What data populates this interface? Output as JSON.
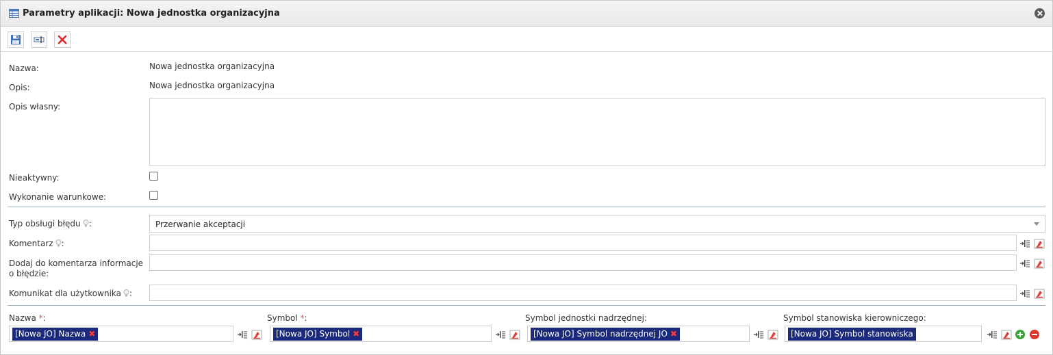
{
  "window": {
    "title": "Parametry aplikacji: Nowa jednostka organizacyjna"
  },
  "toolbar": {
    "save_icon": "save-icon",
    "rename_icon": "rename-field-icon",
    "delete_icon": "delete-icon"
  },
  "fields": {
    "nazwa_label": "Nazwa:",
    "nazwa_value": "Nowa jednostka organizacyjna",
    "opis_label": "Opis:",
    "opis_value": "Nowa jednostka organizacyjna",
    "opis_wlasny_label": "Opis własny:",
    "nieaktywny_label": "Nieaktywny:",
    "wykonanie_label": "Wykonanie warunkowe:"
  },
  "error_section": {
    "typ_label": "Typ obsługi błędu",
    "typ_value": "Przerwanie akceptacji",
    "komentarz_label": "Komentarz",
    "dodaj_label": "Dodaj do komentarza informacje o błędzie:",
    "komunikat_label": "Komunikat dla użytkownika",
    "colon": ":"
  },
  "mapping": {
    "required_mark": "*",
    "colon": ":",
    "nazwa_label": "Nazwa",
    "nazwa_tag": "[Nowa JO] Nazwa",
    "symbol_label": "Symbol",
    "symbol_tag": "[Nowa JO] Symbol",
    "nadrzednej_label": "Symbol jednostki nadrzędnej:",
    "nadrzednej_tag": "[Nowa JO] Symbol nadrzędnej JO",
    "kierowniczego_label": "Symbol stanowiska kierowniczego:",
    "kierowniczego_tag": "[Nowa JO] Symbol stanowiska",
    "tag_remove": "✖"
  },
  "colors": {
    "tag_bg": "#1b2a7a",
    "required": "#d9534f",
    "divider": "#9aaec4",
    "add": "#3aa535",
    "remove": "#d93a2b"
  }
}
